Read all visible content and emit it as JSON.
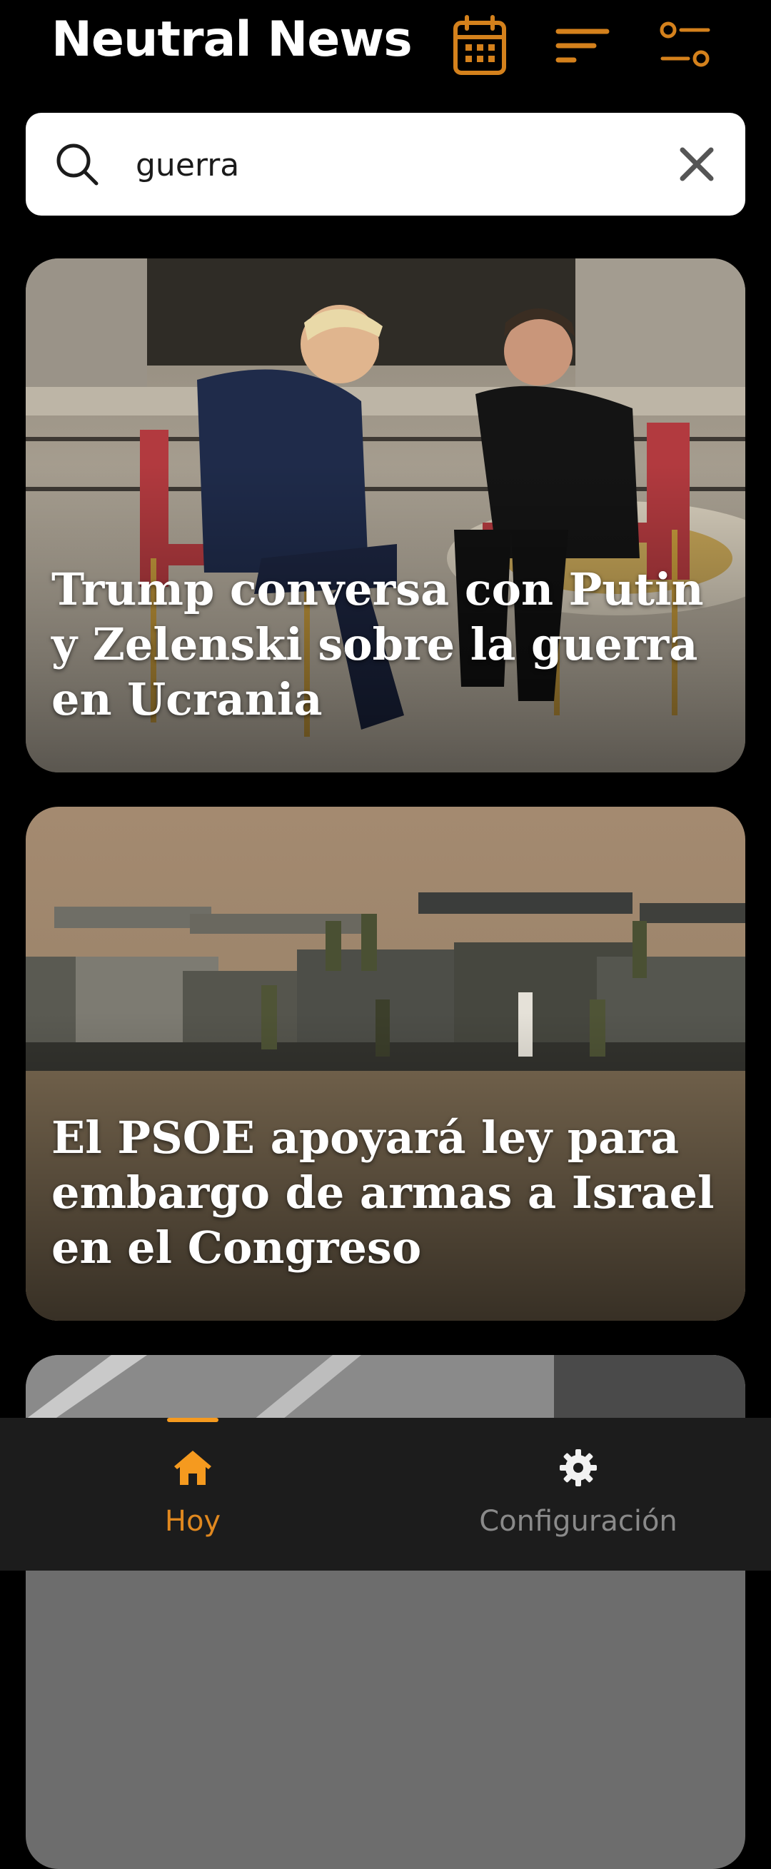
{
  "app": {
    "title": "Neutral News"
  },
  "toolbar": {
    "calendar_icon": "calendar-icon",
    "sort_icon": "sort-icon",
    "filter_icon": "sliders-icon",
    "accent": "#d4811c"
  },
  "search": {
    "value": "guerra",
    "placeholder": ""
  },
  "articles": [
    {
      "title": "Trump conversa con Putin y Zelenski sobre la guerra en Ucrania",
      "image": "two-men-seated-talking-marble-hall"
    },
    {
      "title": "El PSOE apoyará ley para embargo de armas a Israel en el Congreso",
      "image": "armored-vehicles-soldiers-field"
    },
    {
      "title": "",
      "image": "partial-card-photo"
    }
  ],
  "bottom_nav": {
    "items": [
      {
        "label": "Hoy",
        "icon": "home-icon",
        "active": true
      },
      {
        "label": "Configuración",
        "icon": "gear-icon",
        "active": false
      }
    ],
    "active_color": "#f59a1f",
    "inactive_color": "#8a8a8a"
  }
}
